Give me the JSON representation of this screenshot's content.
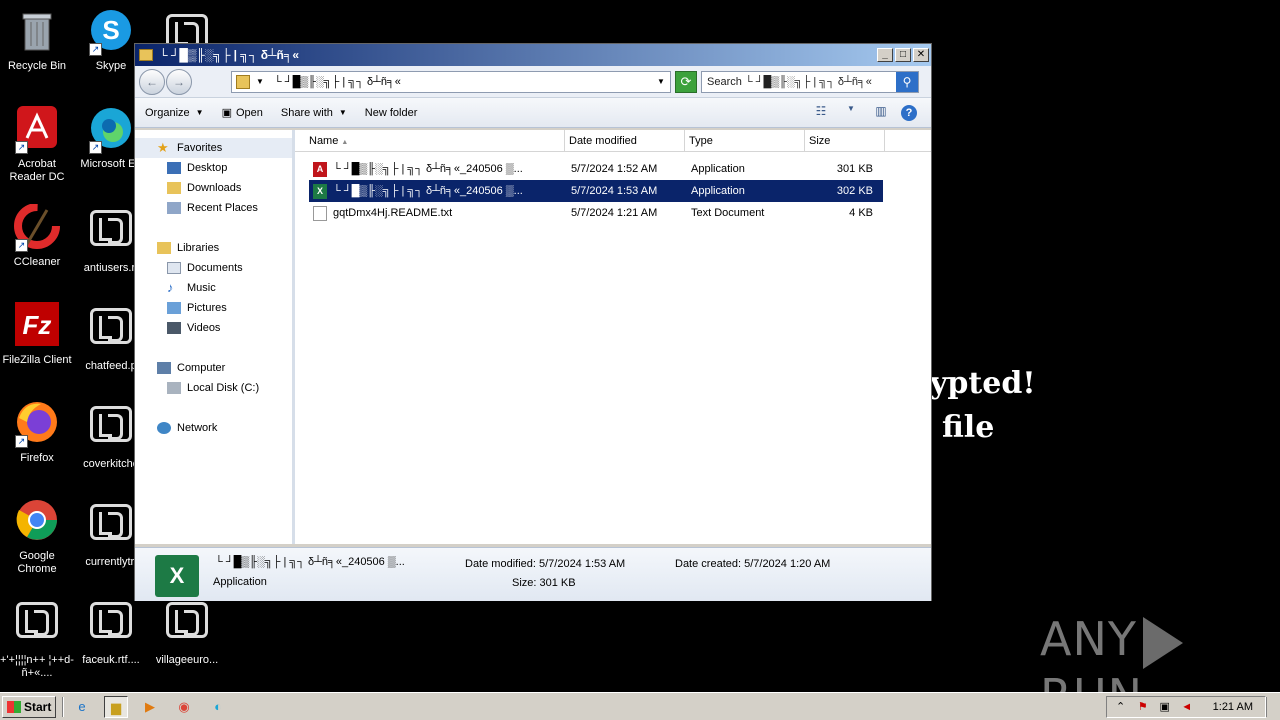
{
  "desktop": {
    "icons": [
      {
        "label": "Recycle Bin",
        "icon": "recycle-bin-icon"
      },
      {
        "label": "Skype",
        "icon": "skype-icon"
      },
      {
        "label": "Acrobat Reader DC",
        "icon": "acrobat-icon"
      },
      {
        "label": "Microsoft Ed",
        "icon": "edge-icon"
      },
      {
        "label": "CCleaner",
        "icon": "ccleaner-icon"
      },
      {
        "label": "antiusers.rt",
        "icon": "lockbit-file-icon"
      },
      {
        "label": "FileZilla Client",
        "icon": "filezilla-icon"
      },
      {
        "label": "chatfeed.p",
        "icon": "lockbit-file-icon"
      },
      {
        "label": "Firefox",
        "icon": "firefox-icon"
      },
      {
        "label": "coverkitche",
        "icon": "lockbit-file-icon"
      },
      {
        "label": "Google Chrome",
        "icon": "chrome-icon"
      },
      {
        "label": "currentlytr.",
        "icon": "lockbit-file-icon"
      },
      {
        "label": "+'+¦¦¦¦n++ ¦++d-ñ+«....",
        "icon": "lockbit-file-icon"
      },
      {
        "label": "faceuk.rtf....",
        "icon": "lockbit-file-icon"
      },
      {
        "label": "villageeuro...",
        "icon": "lockbit-file-icon"
      }
    ],
    "background_text_1": "ypted!",
    "background_text_2": "file",
    "watermark": {
      "left": "ANY",
      "right": "RUN"
    }
  },
  "window": {
    "title": "└ ┘█▒╟░╗├ | ╗┐ δ┴ñ╕«",
    "address": "└ ┘█▒╟░╗├ | ╗┐ δ┴ñ╕«",
    "search_placeholder": "Search └ ┘█▒╟░╗├ | ╗┐ δ┴ñ╕«",
    "toolbar": {
      "organize": "Organize",
      "open": "Open",
      "share_with": "Share with",
      "new_folder": "New folder"
    },
    "nav": {
      "favorites": "Favorites",
      "desktop": "Desktop",
      "downloads": "Downloads",
      "recent_places": "Recent Places",
      "libraries": "Libraries",
      "documents": "Documents",
      "music": "Music",
      "pictures": "Pictures",
      "videos": "Videos",
      "computer": "Computer",
      "local_disk": "Local Disk (C:)",
      "network": "Network"
    },
    "columns": {
      "name": "Name",
      "date": "Date modified",
      "type": "Type",
      "size": "Size"
    },
    "files": [
      {
        "name": "└ ┘█▒╟░╗├ | ╗┐ δ┴ñ╕«_240506 ▒...",
        "date": "5/7/2024 1:52 AM",
        "type": "Application",
        "size": "301 KB",
        "icon": "pdf-app-icon"
      },
      {
        "name": "└ ┘█▒╟░╗├ | ╗┐ δ┴ñ╕«_240506 ▒...",
        "date": "5/7/2024 1:53 AM",
        "type": "Application",
        "size": "302 KB",
        "icon": "excel-app-icon"
      },
      {
        "name": "gqtDmx4Hj.README.txt",
        "date": "5/7/2024 1:21 AM",
        "type": "Text Document",
        "size": "4 KB",
        "icon": "text-file-icon"
      }
    ],
    "details": {
      "name": "└ ┘█▒╟░╗├ | ╗┐ δ┴ñ╕«_240506 ▒...",
      "type": "Application",
      "date_modified": "Date modified: 5/7/2024 1:53 AM",
      "size": "Size: 301 KB",
      "date_created": "Date created: 5/7/2024 1:20 AM"
    }
  },
  "taskbar": {
    "start": "Start",
    "clock": "1:21 AM"
  }
}
